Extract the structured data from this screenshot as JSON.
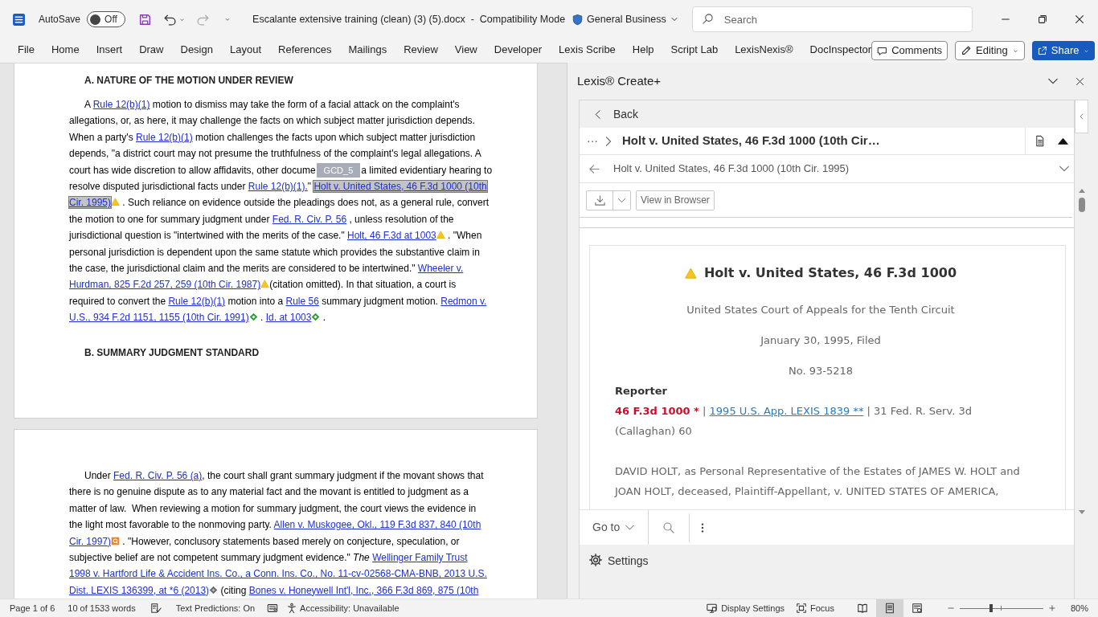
{
  "title_bar": {
    "autosave": {
      "label": "AutoSave",
      "on": false,
      "state_label": "Off"
    },
    "document_title": "Escalante extensive training (clean) (3) (5).docx  -  Compatibility Mode",
    "sensitivity": "General Business",
    "search": {
      "placeholder": "Search"
    }
  },
  "ribbon_tabs": [
    {
      "label": "File",
      "selected": false
    },
    {
      "label": "Home",
      "selected": false
    },
    {
      "label": "Insert",
      "selected": false
    },
    {
      "label": "Draw",
      "selected": false
    },
    {
      "label": "Design",
      "selected": false
    },
    {
      "label": "Layout",
      "selected": false
    },
    {
      "label": "References",
      "selected": false
    },
    {
      "label": "Mailings",
      "selected": false
    },
    {
      "label": "Review",
      "selected": false
    },
    {
      "label": "View",
      "selected": false
    },
    {
      "label": "Developer",
      "selected": false
    },
    {
      "label": "Lexis Scribe",
      "selected": false
    },
    {
      "label": "Help",
      "selected": false
    },
    {
      "label": "Script Lab",
      "selected": false
    },
    {
      "label": "LexisNexis®",
      "selected": false
    },
    {
      "label": "DocInspector",
      "selected": false
    }
  ],
  "ribbon_buttons": [
    {
      "label": "Comments",
      "kind": "comments"
    },
    {
      "label": "Editing",
      "kind": "editing"
    },
    {
      "label": "Share",
      "kind": "share"
    }
  ],
  "document": {
    "pages": [
      {
        "blocks": [
          {
            "kind": "heading",
            "text": "A. NATURE OF THE MOTION UNDER REVIEW"
          },
          {
            "kind": "paragraph",
            "lines": [
              [
                {
                  "kind": "text",
                  "text": "A "
                },
                {
                  "kind": "link",
                  "text": "Rule 12(b)(1)",
                  "selected": false
                },
                {
                  "kind": "text",
                  "text": " motion to dismiss may take the form of a facial attack on the complaint's"
                }
              ],
              [
                {
                  "kind": "text",
                  "text": "allegations, or, as here, it may challenge the facts on which subject matter jurisdiction depends."
                }
              ],
              [
                {
                  "kind": "text",
                  "text": "When a party's "
                },
                {
                  "kind": "link",
                  "text": "Rule 12(b)(1)",
                  "selected": false
                },
                {
                  "kind": "text",
                  "text": " motion challenges the facts upon which subject matter jurisdiction"
                }
              ],
              [
                {
                  "kind": "text",
                  "text": "depends, \"a district court may not presume the truthfulness of the complaint's legal allegations. A"
                }
              ],
              [
                {
                  "kind": "text",
                  "text": "court has wide discretion to allow affidavits, other docume"
                },
                {
                  "kind": "tag",
                  "text": "GCD_5"
                },
                {
                  "kind": "text",
                  "text": "a limited evidentiary hearing to"
                }
              ],
              [
                {
                  "kind": "text",
                  "text": "resolve disputed jurisdictional facts under "
                },
                {
                  "kind": "link",
                  "text": "Rule 12(b)(1).",
                  "selected": false
                },
                {
                  "kind": "text",
                  "text": "\" "
                },
                {
                  "kind": "link",
                  "text": "Holt v. United States, 46 F.3d 1000 (10th",
                  "selected": true
                }
              ],
              [
                {
                  "kind": "link",
                  "text": "Cir. 1995)",
                  "selected": true
                },
                {
                  "kind": "caution"
                },
                {
                  "kind": "text",
                  "text": " . Such reliance on evidence outside the pleadings does not, as a general rule, convert"
                }
              ],
              [
                {
                  "kind": "text",
                  "text": "the motion to one for summary judgment under "
                },
                {
                  "kind": "link",
                  "text": "Fed. R. Civ. P. 56",
                  "selected": false
                },
                {
                  "kind": "text",
                  "text": " , unless resolution of the"
                }
              ],
              [
                {
                  "kind": "text",
                  "text": "jurisdictional question is \"intertwined with the merits of the case.\" "
                },
                {
                  "kind": "link",
                  "text": "Holt, 46 F.3d at 1003",
                  "selected": false
                },
                {
                  "kind": "caution"
                },
                {
                  "kind": "text",
                  "text": " . \"When"
                }
              ],
              [
                {
                  "kind": "text",
                  "text": "personal jurisdiction is dependent upon the same statute which provides the substantive claim in"
                }
              ],
              [
                {
                  "kind": "text",
                  "text": "the case, the jurisdictional claim and the merits are considered to be intertwined.\" "
                },
                {
                  "kind": "link",
                  "text": "Wheeler v.",
                  "selected": false
                }
              ],
              [
                {
                  "kind": "link",
                  "text": "Hurdman, 825 F.2d 257, 259 (10th Cir. 1987)",
                  "selected": false
                },
                {
                  "kind": "caution"
                },
                {
                  "kind": "text",
                  "text": "(citation omitted). In that situation, a court is"
                }
              ],
              [
                {
                  "kind": "text",
                  "text": "required to convert the "
                },
                {
                  "kind": "link",
                  "text": "Rule 12(b)(1)",
                  "selected": false
                },
                {
                  "kind": "text",
                  "text": " motion into a "
                },
                {
                  "kind": "link",
                  "text": "Rule 56",
                  "selected": false
                },
                {
                  "kind": "text",
                  "text": " summary judgment motion. "
                },
                {
                  "kind": "link",
                  "text": "Redmon v.",
                  "selected": false
                }
              ],
              [
                {
                  "kind": "link",
                  "text": "U.S., 934 F.2d 1151, 1155 (10th Cir. 1991)",
                  "selected": false
                },
                {
                  "kind": "positive"
                },
                {
                  "kind": "text",
                  "text": " . "
                },
                {
                  "kind": "link",
                  "text": "Id. at 1003",
                  "selected": false
                },
                {
                  "kind": "positive"
                },
                {
                  "kind": "text",
                  "text": " ."
                }
              ]
            ]
          },
          {
            "kind": "heading",
            "text": "B. SUMMARY JUDGMENT STANDARD"
          }
        ]
      },
      {
        "blocks": [
          {
            "kind": "paragraph",
            "lines": [
              [
                {
                  "kind": "text",
                  "text": "Under "
                },
                {
                  "kind": "link",
                  "text": "Fed. R. Civ. P. 56 (a)",
                  "selected": false
                },
                {
                  "kind": "text",
                  "text": ", the court shall grant summary judgment if the movant shows that"
                }
              ],
              [
                {
                  "kind": "text",
                  "text": "there is no genuine dispute as to any material fact and the movant is entitled to judgment as a"
                }
              ],
              [
                {
                  "kind": "text",
                  "text": "matter of law.  When reviewing a motion for summary judgment, the court views the evidence in"
                }
              ],
              [
                {
                  "kind": "text",
                  "text": "the light most favorable to the nonmoving party. "
                },
                {
                  "kind": "link",
                  "text": "Allen v. Muskogee, Okl., 119 F.3d 837, 840 (10th",
                  "selected": false
                }
              ],
              [
                {
                  "kind": "link",
                  "text": "Cir. 1997)",
                  "selected": false
                },
                {
                  "kind": "questioned"
                },
                {
                  "kind": "text",
                  "text": " . \"However, conclusory statements based merely on conjecture, speculation, or"
                }
              ],
              [
                {
                  "kind": "text",
                  "text": "subjective belief are not competent summary judgment evidence.\" "
                },
                {
                  "kind": "italic",
                  "text": "The "
                },
                {
                  "kind": "link",
                  "text": "Wellinger Family Trust",
                  "selected": false
                }
              ],
              [
                {
                  "kind": "link",
                  "text": "1998 v. Hartford Life & Accident Ins. Co., a Conn. Ins. Co., No. 11-cv-02568-CMA-BNB, 2013 U.S.",
                  "selected": false
                }
              ],
              [
                {
                  "kind": "link",
                  "text": "Dist. LEXIS 136399, at *6 (2013)",
                  "selected": false
                },
                {
                  "kind": "neutral"
                },
                {
                  "kind": "text",
                  "text": " (citing "
                },
                {
                  "kind": "link",
                  "text": "Bones v. Honeywell Int'l, Inc., 366 F.3d 869, 875 (10th",
                  "selected": false
                }
              ]
            ]
          }
        ]
      }
    ]
  },
  "side_pane": {
    "title": "Lexis® Create+",
    "back_label": "Back",
    "breadcrumb": {
      "ellipsis": "···",
      "title": "Holt v. United States, 46 F.3d 1000 (10th Cir…"
    },
    "document_title": "Holt v. United States, 46 F.3d 1000 (10th Cir. 1995)",
    "view_in_browser": "View in Browser",
    "card": {
      "title": "Holt v. United States, 46 F.3d 1000",
      "court": "United States Court of Appeals for the Tenth Circuit",
      "date": "January 30, 1995, Filed",
      "docket": "No. 93-5218",
      "reporter_label": "Reporter",
      "reporter": [
        {
          "kind": "primary",
          "text": "46 F.3d 1000 *"
        },
        {
          "kind": "plain",
          "text": " | "
        },
        {
          "kind": "link",
          "text": "1995 U.S. App. LEXIS 1839 **"
        },
        {
          "kind": "plain",
          "text": " | 31 Fed. R. Serv. 3d (Callaghan) 60"
        }
      ],
      "parties": "DAVID HOLT, as Personal Representative of the Estates of JAMES W. HOLT and JOAN HOLT, deceased, Plaintiff-Appellant, v. UNITED STATES OF AMERICA,"
    },
    "goto_label": "Go to",
    "settings_label": "Settings"
  },
  "status_bar": {
    "page": "Page 1 of 6",
    "words": "10 of 1533 words",
    "text_predictions": "Text Predictions: On",
    "accessibility": "Accessibility: Unavailable",
    "display_settings": "Display Settings",
    "focus": "Focus",
    "views": [
      {
        "kind": "read",
        "selected": false
      },
      {
        "kind": "print",
        "selected": true
      },
      {
        "kind": "web",
        "selected": false
      }
    ],
    "zoom": {
      "level": 0.38,
      "reading": "80%"
    }
  }
}
